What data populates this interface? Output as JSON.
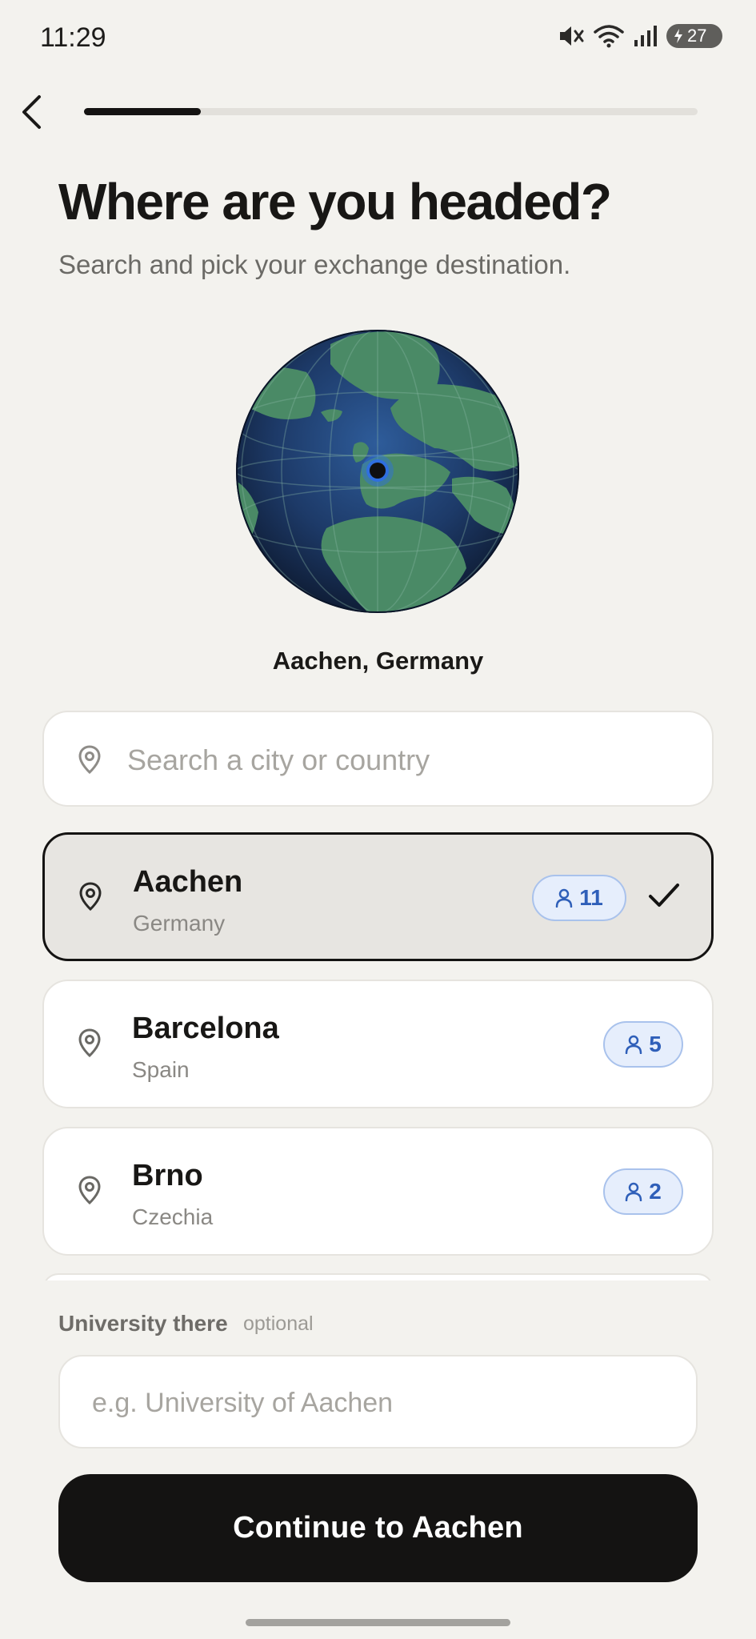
{
  "status_bar": {
    "time": "11:29",
    "battery": "27",
    "icons": [
      "mute-icon",
      "wifi-icon",
      "signal-icon",
      "battery-icon"
    ]
  },
  "header": {
    "back_icon": "chevron-left-icon",
    "progress_fraction": 0.19
  },
  "title": "Where are you headed?",
  "subtitle": "Search and pick your exchange destination.",
  "globe": {
    "selected_label": "Aachen, Germany",
    "ocean_color": "#1f3f73",
    "land_color": "#4a8a66",
    "marker_color": "#2f6fe0"
  },
  "search": {
    "placeholder": "Search a city or country",
    "value": ""
  },
  "cities": [
    {
      "name": "Aachen",
      "country": "Germany",
      "count": "11",
      "selected": true
    },
    {
      "name": "Barcelona",
      "country": "Spain",
      "count": "5",
      "selected": false
    },
    {
      "name": "Brno",
      "country": "Czechia",
      "count": "2",
      "selected": false
    }
  ],
  "university": {
    "label": "University there",
    "optional": "optional",
    "placeholder": "e.g. University of Aachen",
    "value": ""
  },
  "continue_label": "Continue to Aachen",
  "colors": {
    "background": "#f3f2ee",
    "primary": "#141312",
    "badge_text": "#2f5fb9",
    "badge_bg": "#e6eefc"
  }
}
